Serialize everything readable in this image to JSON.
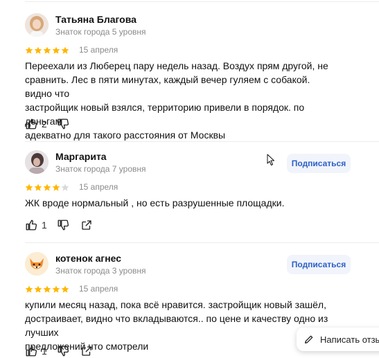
{
  "colors": {
    "star_filled": "#FFB600",
    "star_empty": "#D9D9D9",
    "subscribe_bg": "#F1F4FA",
    "subscribe_text": "#2B5FC8"
  },
  "reviews": [
    {
      "name": "Татьяна Благова",
      "level": "Знаток города 5 уровня",
      "rating": 5,
      "date": "15 апреля",
      "lines": [
        "Переехали из Люберец пару недель назад. Воздух прям другой, не",
        "сравнить. Лес в пяти минутах, каждый вечер гуляем с собакой. видно что",
        "застройщик новый взялся, территорию привели в порядок. по деньгам",
        "адекватно для такого расстояния от Москвы"
      ],
      "likes": "2",
      "avatar_icon": "woman-photo-avatar"
    },
    {
      "name": "Маргарита",
      "level": "Знаток города 7 уровня",
      "rating": 4,
      "date": "15 апреля",
      "lines": [
        "ЖК вроде нормальный , но есть разрушенные площадки."
      ],
      "likes": "1",
      "subscribe_label": "Подписаться",
      "avatar_icon": "photo-avatar"
    },
    {
      "name": "котенок агнес",
      "level": "Знаток города 3 уровня",
      "rating": 5,
      "date": "15 апреля",
      "lines": [
        "купили месяц назад, пока всё нравится. застройщик новый зашёл,",
        "достраивает, видно что вкладываются.. по цене и качеству одно из лучших",
        "предложений что смотрели"
      ],
      "likes": "1",
      "subscribe_label": "Подписаться",
      "avatar_icon": "fox-avatar"
    }
  ],
  "write_review_label": "Написать отзыв"
}
